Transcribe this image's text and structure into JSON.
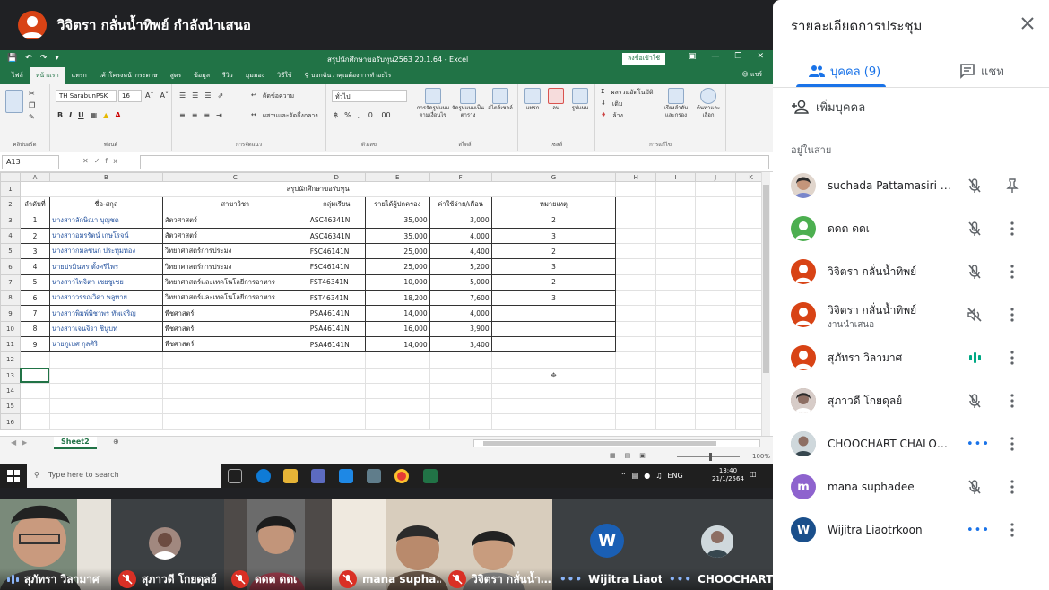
{
  "presenter": {
    "title": "วิจิตรา กลั่นน้ำทิพย์ กำลังนำเสนอ",
    "avatar_color": "#d84315"
  },
  "excel": {
    "window_title": "สรุปนักศึกษาขอรับทุน2563 20.1.64  -  Excel",
    "signin": "ลงชื่อเข้าใช้",
    "tabs": [
      "ไฟล์",
      "หน้าแรก",
      "แทรก",
      "เค้าโครงหน้ากระดาษ",
      "สูตร",
      "ข้อมูล",
      "รีวิว",
      "มุมมอง",
      "วิธีใช้"
    ],
    "tell_me": "บอกฉันว่าคุณต้องการทำอะไร",
    "share": "แชร์",
    "ribbon": {
      "font_name": "TH SarabunPSK",
      "font_size": "16",
      "number_format": "ทั่วไป",
      "wrap_text": "ตัดข้อความ",
      "merge_center": "ผสานและจัดกึ่งกลาง",
      "autosum": "ผลรวมอัตโนมัติ",
      "fill": "เติม",
      "clear": "ล้าง",
      "sort_filter": "เรียงลำดับและกรอง",
      "find_select": "ค้นหาและเลือก",
      "cond_format": "การจัดรูปแบบตามเงื่อนไข",
      "format_table": "จัดรูปแบบเป็นตาราง",
      "cell_styles": "สไตล์เซลล์",
      "insert": "แทรก",
      "delete": "ลบ",
      "format": "รูปแบบ",
      "groups": {
        "clipboard": "คลิปบอร์ด",
        "font": "ฟอนต์",
        "alignment": "การจัดแนว",
        "number": "ตัวเลข",
        "styles": "สไตล์",
        "cells": "เซลล์",
        "editing": "การแก้ไข"
      }
    },
    "name_box": "A13",
    "columns": [
      "A",
      "B",
      "C",
      "D",
      "E",
      "F",
      "G",
      "H",
      "I",
      "J",
      "K"
    ],
    "rows": [
      "1",
      "2",
      "3",
      "4",
      "5",
      "6",
      "7",
      "8",
      "9",
      "10",
      "11",
      "12",
      "13",
      "14",
      "15",
      "16"
    ],
    "sheet_title": "สรุปนักศึกษาขอรับทุน",
    "headers": [
      "ลำดับที่",
      "ชื่อ-สกุล",
      "สาขาวิชา",
      "กลุ่มเรียน",
      "รายได้ผู้ปกครอง",
      "ค่าใช้จ่าย/เดือน",
      "หมายเหตุ"
    ],
    "data": [
      [
        "1",
        "นางสาวลักษิณา บุญชด",
        "สัตวศาสตร์",
        "ASC46341N",
        "35,000",
        "3,000",
        "2"
      ],
      [
        "2",
        "นางสาวอมรรัตน์ เกษโรจน์",
        "สัตวศาสตร์",
        "ASC46341N",
        "35,000",
        "4,000",
        "3"
      ],
      [
        "3",
        "นางสาวกมลชนก ประทุมทอง",
        "วิทยาศาสตร์การประมง",
        "FSC46141N",
        "25,000",
        "4,400",
        "2"
      ],
      [
        "4",
        "นายปรมินทร ตั้งศรีไพร",
        "วิทยาศาสตร์การประมง",
        "FSC46141N",
        "25,000",
        "5,200",
        "3"
      ],
      [
        "5",
        "นางสาวไพจิตา เชยชูเชย",
        "วิทยาศาสตร์และเทคโนโลยีการอาหาร",
        "FST46341N",
        "10,000",
        "5,000",
        "2"
      ],
      [
        "6",
        "นางสาววรรณวิศา พลูทาย",
        "วิทยาศาสตร์และเทคโนโลยีการอาหาร",
        "FST46341N",
        "18,200",
        "7,600",
        "3"
      ],
      [
        "7",
        "นางสาวพิมพ์พิชาพร ทัพเจริญ",
        "พืชศาสตร์",
        "PSA46141N",
        "14,000",
        "4,000",
        ""
      ],
      [
        "8",
        "นางสาวเจนจิรา ชินูบท",
        "พืชศาสตร์",
        "PSA46141N",
        "16,000",
        "3,900",
        ""
      ],
      [
        "9",
        "นายภูเบศ กุลศิริ",
        "พืชศาสตร์",
        "PSA46141N",
        "14,000",
        "3,400",
        ""
      ]
    ],
    "sheet_tab": "Sheet2",
    "zoom": "100%"
  },
  "taskbar": {
    "search_placeholder": "Type here to search",
    "lang": "ENG",
    "time": "13:40",
    "date": "21/1/2564"
  },
  "filmstrip": [
    {
      "name": "สุภัทรา วิลามาศ",
      "state": "talking"
    },
    {
      "name": "สุภาวดี โกยดุลย์",
      "state": "muted"
    },
    {
      "name": "ดดด ดดเ",
      "state": "muted"
    },
    {
      "name": "mana supha…",
      "state": "muted"
    },
    {
      "name": "วิจิตรา กลั่นน้ำ…",
      "state": "muted"
    },
    {
      "name": "Wijitra Liaotr…",
      "state": "idle",
      "initial": "W"
    },
    {
      "name": "CHOOCHART…",
      "state": "idle"
    }
  ],
  "panel": {
    "title": "รายละเอียดการประชุม",
    "tab_people": "บุคคล (9)",
    "tab_chat": "แชท",
    "add_people": "เพิ่มบุคคล",
    "section": "อยู่ในสาย",
    "participants": [
      {
        "name": "suchada Pattamasiri (คุณ)",
        "sub": "",
        "state": "muted"
      },
      {
        "name": "ดดด ดดเ",
        "sub": "",
        "state": "muted"
      },
      {
        "name": "วิจิตรา กลั่นน้ำทิพย์",
        "sub": "",
        "state": "muted"
      },
      {
        "name": "วิจิตรา กลั่นน้ำทิพย์",
        "sub": "งานนำเสนอ",
        "state": "presenting"
      },
      {
        "name": "สุภัทรา วิลามาศ",
        "sub": "",
        "state": "talking"
      },
      {
        "name": "สุภาวดี โกยดุลย์",
        "sub": "",
        "state": "muted"
      },
      {
        "name": "CHOOCHART CHALOE…",
        "sub": "",
        "state": "idle"
      },
      {
        "name": "mana suphadee",
        "sub": "",
        "state": "muted",
        "initial": "m"
      },
      {
        "name": "Wijitra Liaotrkoon",
        "sub": "",
        "state": "idle",
        "initial": "W"
      }
    ]
  },
  "colors": {
    "excel_green": "#217346",
    "meet_blue": "#1a73e8",
    "mute_red": "#d93025"
  }
}
